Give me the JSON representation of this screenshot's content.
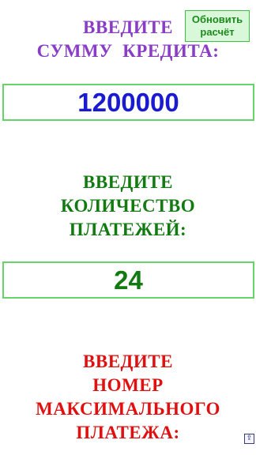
{
  "refresh_button": {
    "line1": "Обновить",
    "line2": "расчёт"
  },
  "loan_amount": {
    "label_lines": [
      "ВВЕДИТЕ",
      "СУММУ  КРЕДИТА:"
    ],
    "value": "1200000"
  },
  "payments_count": {
    "label_lines": [
      "ВВЕДИТЕ",
      "КОЛИЧЕСТВО",
      "ПЛАТЕЖЕЙ:"
    ],
    "value": "24"
  },
  "max_payment": {
    "label_lines": [
      "ВВЕДИТЕ",
      "НОМЕР",
      "МАКСИМАЛЬНОГО",
      "ПЛАТЕЖА:"
    ]
  },
  "scroll_top_icon": "⇪",
  "colors": {
    "amount_label": "#8a3cc7",
    "amount_value": "#1a1ad0",
    "payments": "#117a11",
    "max_payment": "#e01010",
    "field_border": "#66d466"
  }
}
